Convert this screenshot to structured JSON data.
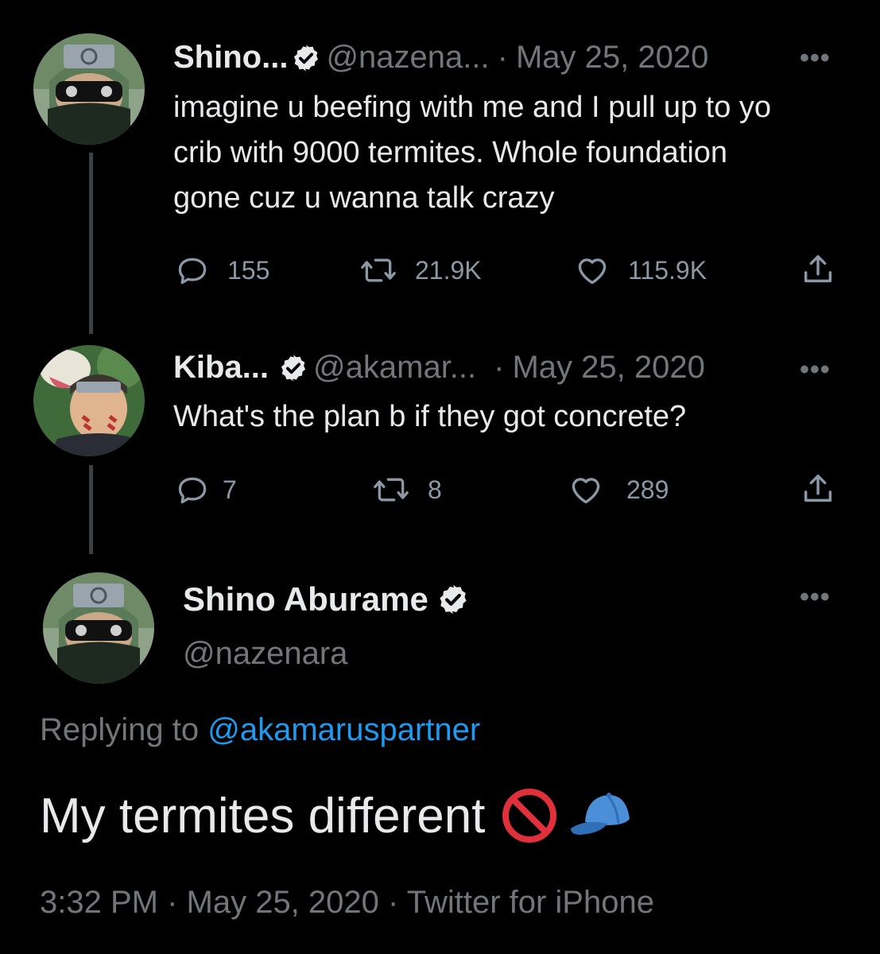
{
  "thread": [
    {
      "display_name": "Shino...",
      "handle": "@nazena...",
      "separator": "·",
      "date": "May 25, 2020",
      "more": "•••",
      "text_lines": [
        "imagine u beefing with me and I pull up to yo",
        "crib with 9000 termites. Whole foundation",
        "gone cuz u wanna talk crazy"
      ],
      "replies": "155",
      "retweets": "21.9K",
      "likes": "115.9K"
    },
    {
      "display_name": "Kiba...",
      "handle": "@akamar...",
      "separator": "·",
      "date": "May 25, 2020",
      "more": "•••",
      "text_lines": [
        "What's the plan b if they got concrete?"
      ],
      "replies": "7",
      "retweets": "8",
      "likes": "289"
    }
  ],
  "main_tweet": {
    "display_name": "Shino Aburame",
    "handle": "@nazenara",
    "more": "•••",
    "replying_prefix": "Replying to ",
    "replying_to": "@akamaruspartner",
    "text": "My termites different",
    "emojis": [
      "no-entry-sign-icon",
      "blue-cap-icon"
    ],
    "footer": "3:32 PM · May 25, 2020 · Twitter for iPhone"
  },
  "colors": {
    "background": "#000000",
    "text": "#e7e9ea",
    "muted": "#71767b",
    "link": "#1d9bf0",
    "thread_line": "#3e4144"
  }
}
